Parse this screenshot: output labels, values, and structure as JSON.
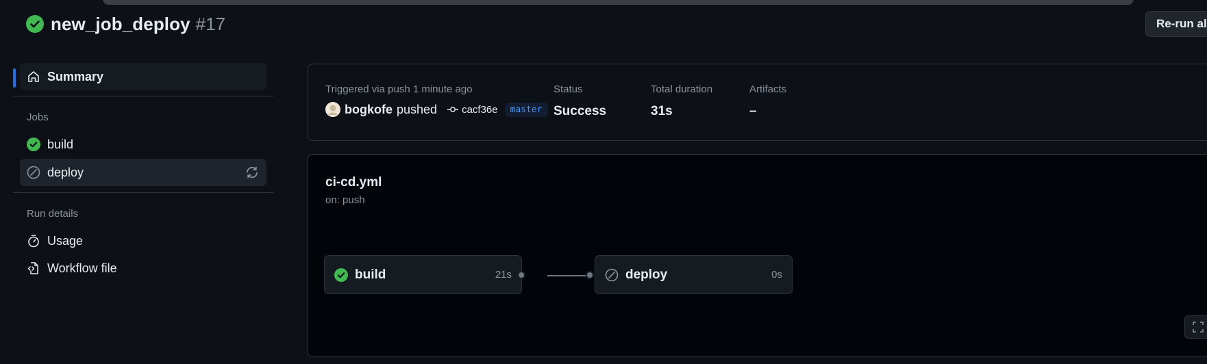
{
  "header": {
    "title": "new_job_deploy",
    "run_number": "#17",
    "rerun_label": "Re-run all jobs"
  },
  "sidebar": {
    "summary_label": "Summary",
    "jobs_heading": "Jobs",
    "jobs": [
      {
        "label": "build",
        "status": "success"
      },
      {
        "label": "deploy",
        "status": "skipped"
      }
    ],
    "run_details_heading": "Run details",
    "details": [
      {
        "label": "Usage",
        "icon": "stopwatch-icon"
      },
      {
        "label": "Workflow file",
        "icon": "file-code-icon"
      }
    ]
  },
  "summary": {
    "trigger_text": "Triggered via push 1 minute ago",
    "actor": "bogkofe",
    "action": "pushed",
    "commit": "cacf36e",
    "branch": "master",
    "status_label": "Status",
    "status_value": "Success",
    "duration_label": "Total duration",
    "duration_value": "31s",
    "artifacts_label": "Artifacts",
    "artifacts_value": "–"
  },
  "workflow": {
    "file": "ci-cd.yml",
    "trigger": "on: push",
    "jobs": [
      {
        "name": "build",
        "time": "21s",
        "status": "success"
      },
      {
        "name": "deploy",
        "time": "0s",
        "status": "skipped"
      }
    ]
  },
  "colors": {
    "background": "#0d1117",
    "success": "#3fb950",
    "accent": "#1f6feb",
    "muted": "#8b949e"
  }
}
